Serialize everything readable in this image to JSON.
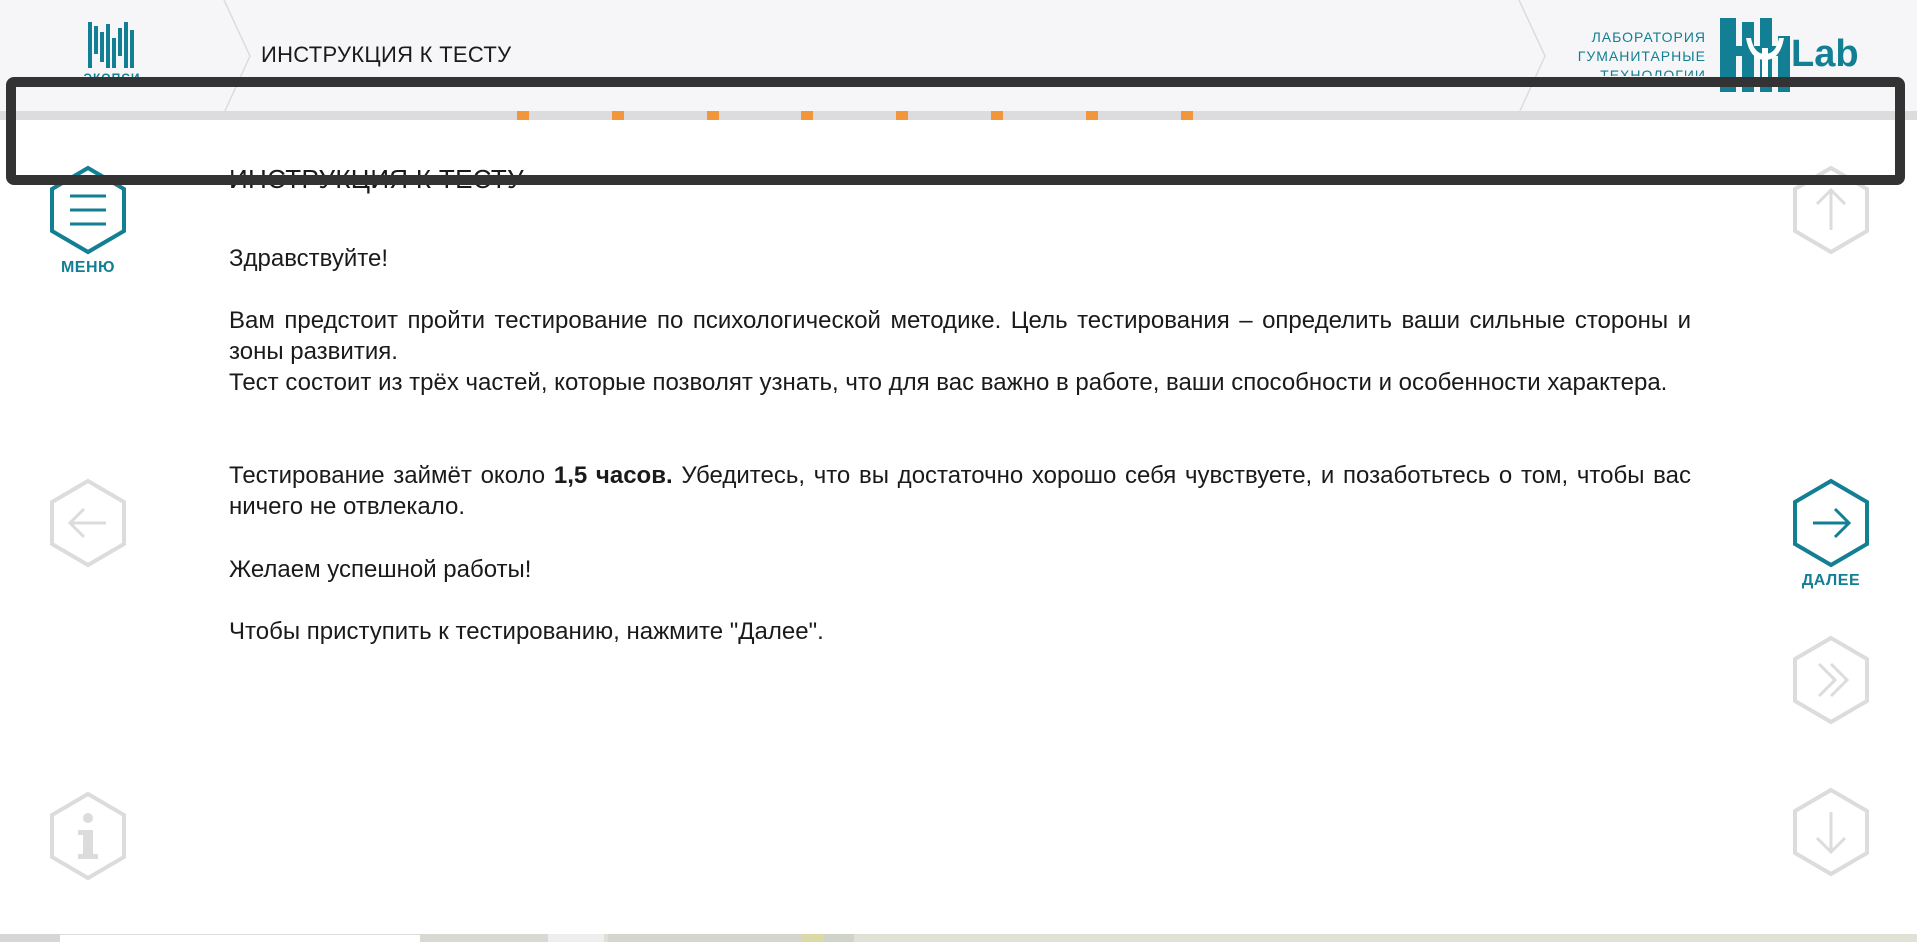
{
  "header": {
    "title": "ИНСТРУКЦИЯ К ТЕСТУ",
    "left_logo_caption": "ЭКОПСИ",
    "lab": {
      "line1": "ЛАБОРАТОРИЯ",
      "line2": "ГУМАНИТАРНЫЕ",
      "line3": "ТЕХНОЛОГИИ",
      "word": "Lab"
    }
  },
  "progress": {
    "marker_count": 8
  },
  "nav": {
    "menu_label": "МЕНЮ",
    "next_label": "ДАЛЕЕ"
  },
  "main": {
    "page_title": "ИНСТРУКЦИЯ К ТЕСТУ",
    "greeting": "Здравствуйте!",
    "p1": "Вам предстоит пройти тестирование по психологической методике. Цель тестирования – определить ваши сильные стороны и зоны развития.",
    "p2": "Тест состоит из трёх частей, которые позволят узнать, что для вас важно в работе, ваши способности и особенности характера.",
    "p3_before": "Тестирование займёт около ",
    "p3_bold": "1,5 часов.",
    "p3_after": " Убедитесь, что вы достаточно хорошо себя чувствуете, и позаботьтесь о том, чтобы вас ничего не отвлекало.",
    "wish": "Желаем успешной работы!",
    "cta": "Чтобы приступить к тестированию, нажмите \"Далее\"."
  },
  "colors": {
    "accent": "#127f94",
    "disabled": "#dcdcdc",
    "progress_marker": "#f2963a",
    "progress_track": "#dcdcdf",
    "header_bg": "#f6f6f8",
    "overlay": "#333333"
  }
}
